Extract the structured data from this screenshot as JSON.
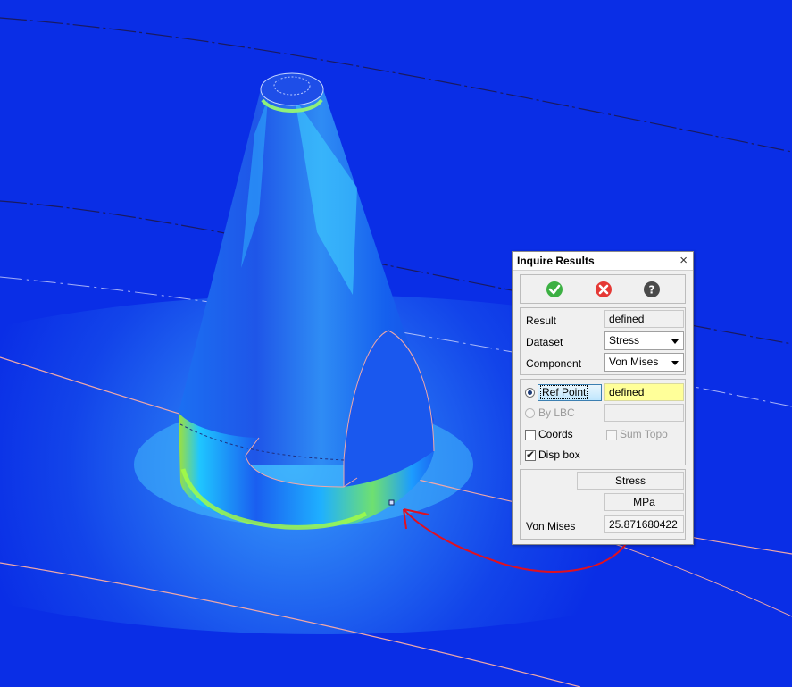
{
  "dialog": {
    "title": "Inquire Results",
    "close_glyph": "×",
    "actions": [
      {
        "name": "ok-icon",
        "color": "#3cb043"
      },
      {
        "name": "cancel-icon",
        "color": "#e53935"
      },
      {
        "name": "help-icon",
        "color": "#4a4a4a"
      }
    ],
    "fields": {
      "result_label": "Result",
      "result_value": "defined",
      "dataset_label": "Dataset",
      "dataset_value": "Stress",
      "component_label": "Component",
      "component_value": "Von Mises"
    },
    "options": {
      "ref_point_label": "Ref Point",
      "ref_point_value": "defined",
      "ref_point_selected": true,
      "by_lbc_label": "By LBC",
      "by_lbc_value": "",
      "coords_label": "Coords",
      "coords_checked": false,
      "sum_topo_label": "Sum Topo",
      "sum_topo_checked": false,
      "disp_box_label": "Disp box",
      "disp_box_checked": true
    },
    "output": {
      "quantity": "Stress",
      "unit": "MPa",
      "component_label": "Von Mises",
      "value": "25.871680422"
    }
  },
  "colors": {
    "background_blue": "#0a2ee6",
    "highlight_yellow": "#ffff99",
    "annotation_red": "#e01020",
    "edge_lines": "#f0a8a8"
  }
}
